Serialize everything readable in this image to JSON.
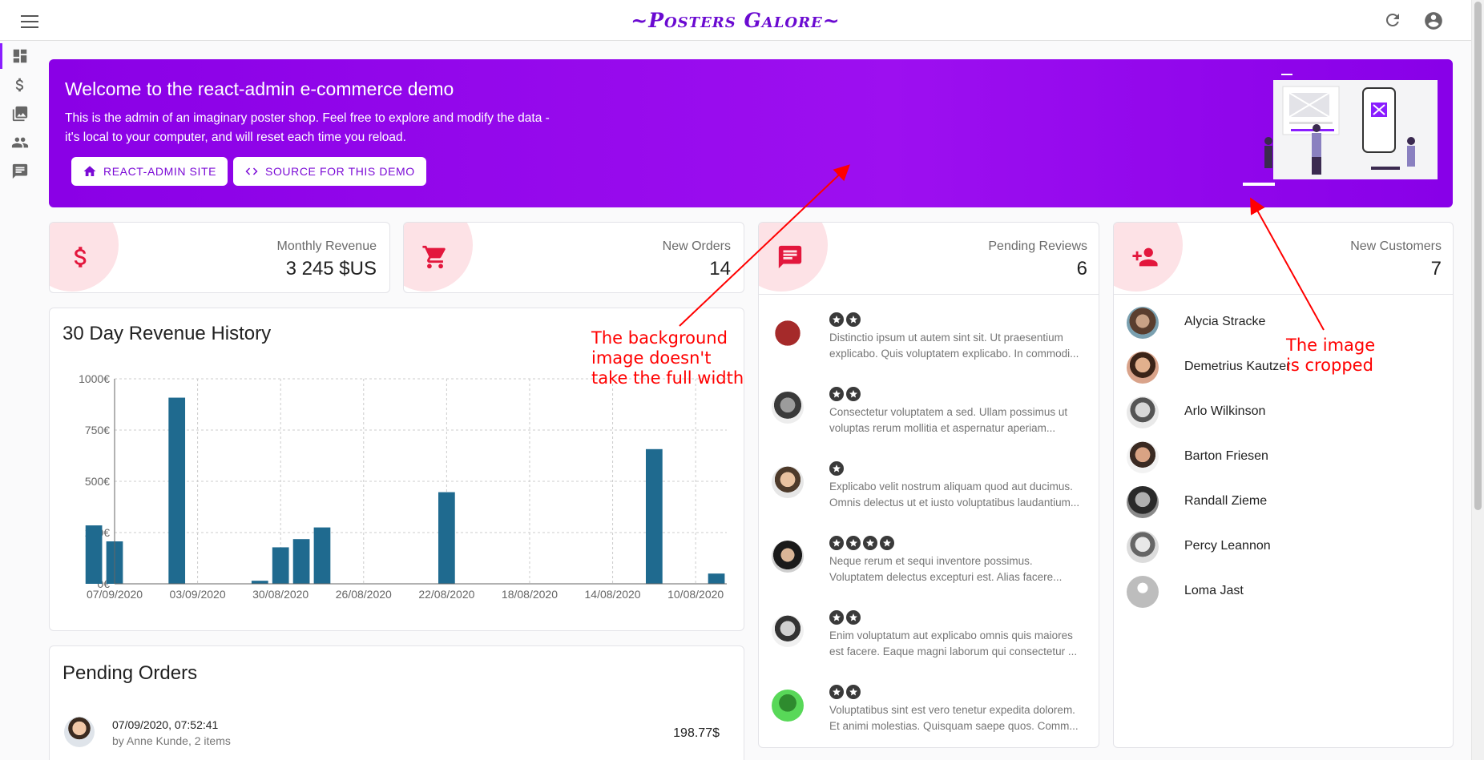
{
  "appbar": {
    "title": "~Posters Galore~"
  },
  "sidebar": {
    "items": [
      "dashboard-icon",
      "dollar-icon",
      "image-icon",
      "people-icon",
      "comment-icon"
    ]
  },
  "welcome": {
    "title": "Welcome to the react-admin e-commerce demo",
    "text_line1": "This is the admin of an imaginary poster shop. Feel free to explore and modify the data -",
    "text_line2": "it's local to your computer, and will reset each time you reload.",
    "btn_site": "REACT-ADMIN SITE",
    "btn_source": "SOURCE FOR THIS DEMO"
  },
  "stats": {
    "revenue": {
      "label": "Monthly Revenue",
      "value": "3 245 $US"
    },
    "orders": {
      "label": "New Orders",
      "value": "14"
    },
    "reviews": {
      "label": "Pending Reviews",
      "value": "6"
    },
    "customers": {
      "label": "New Customers",
      "value": "7"
    }
  },
  "chart_card": {
    "title": "30 Day Revenue History"
  },
  "chart_data": {
    "type": "bar",
    "title": "30 Day Revenue History",
    "xlabel": "",
    "ylabel": "",
    "ylim": [
      0,
      1000
    ],
    "y_ticks": [
      "0€",
      "250€",
      "500€",
      "750€",
      "1000€"
    ],
    "x_tick_labels": [
      "07/09/2020",
      "03/09/2020",
      "30/08/2020",
      "26/08/2020",
      "22/08/2020",
      "18/08/2020",
      "14/08/2020",
      "10/08/2020"
    ],
    "x_axis_order": "descending dates, left to right",
    "series": [
      {
        "values": [
          {
            "x": "08/09/2020",
            "y": 285
          },
          {
            "x": "07/09/2020",
            "y": 207
          },
          {
            "x": "04/09/2020",
            "y": 908
          },
          {
            "x": "31/08/2020",
            "y": 15
          },
          {
            "x": "30/08/2020",
            "y": 178
          },
          {
            "x": "29/08/2020",
            "y": 218
          },
          {
            "x": "28/08/2020",
            "y": 275
          },
          {
            "x": "22/08/2020",
            "y": 447
          },
          {
            "x": "12/08/2020",
            "y": 657
          },
          {
            "x": "09/08/2020",
            "y": 50
          }
        ]
      }
    ],
    "grid": true,
    "bar_color": "#1f6a8f"
  },
  "orders_card": {
    "title": "Pending Orders",
    "rows": [
      {
        "date": "07/09/2020, 07:52:41",
        "by": "by Anne Kunde, 2 items",
        "amount": "198.77$"
      }
    ]
  },
  "reviews": [
    {
      "stars": 2,
      "line1": "Distinctio ipsum ut autem sint sit. Ut praesentium",
      "line2": "explicabo. Quis voluptatem explicabo. In commodi..."
    },
    {
      "stars": 2,
      "line1": "Consectetur voluptatem a sed. Ullam possimus ut",
      "line2": "voluptas rerum mollitia et aspernatur aperiam..."
    },
    {
      "stars": 1,
      "line1": "Explicabo velit nostrum aliquam quod aut ducimus.",
      "line2": "Omnis delectus ut et iusto voluptatibus laudantium..."
    },
    {
      "stars": 4,
      "line1": "Neque rerum et sequi inventore possimus.",
      "line2": "Voluptatem delectus excepturi est. Alias facere..."
    },
    {
      "stars": 2,
      "line1": "Enim voluptatum aut explicabo omnis quis maiores",
      "line2": "est facere. Eaque magni laborum qui consectetur ..."
    },
    {
      "stars": 2,
      "line1": "Voluptatibus sint est vero tenetur expedita dolorem.",
      "line2": "Et animi molestias. Quisquam saepe quos. Comm..."
    }
  ],
  "customers": [
    {
      "name": "Alycia Stracke"
    },
    {
      "name": "Demetrius Kautzer"
    },
    {
      "name": "Arlo Wilkinson"
    },
    {
      "name": "Barton Friesen"
    },
    {
      "name": "Randall Zieme"
    },
    {
      "name": "Percy Leannon"
    },
    {
      "name": "Loma Jast"
    }
  ],
  "annotations": {
    "bg_line1": "The background",
    "bg_line2": "image doesn't",
    "bg_line3": "take the full width",
    "crop_line1": "The image",
    "crop_line2": "is cropped",
    "color": "#ff0000"
  },
  "colors": {
    "accent": "#8a1dff",
    "stat_icon": "#e3173d",
    "stat_blob": "#fde2e6",
    "bar": "#1f6a8f"
  }
}
